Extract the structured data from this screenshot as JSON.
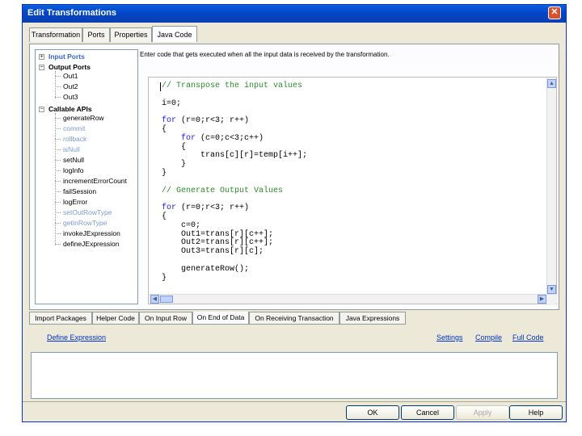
{
  "window": {
    "title": "Edit Transformations"
  },
  "top_tabs": [
    {
      "label": "Transformation"
    },
    {
      "label": "Ports"
    },
    {
      "label": "Properties"
    },
    {
      "label": "Java Code"
    }
  ],
  "tree": {
    "input_ports": "Input Ports",
    "output_ports": "Output Ports",
    "outputs": [
      "Out1",
      "Out2",
      "Out3"
    ],
    "callable_apis": "Callable APIs",
    "apis": [
      "generateRow",
      "commit",
      "rollback",
      "isNull",
      "setNull",
      "logInfo",
      "incrementErrorCount",
      "failSession",
      "logError",
      "setOutRowType",
      "getInRowType",
      "invokeJExpression",
      "defineJExpression"
    ]
  },
  "instruction": "Enter code that gets executed when all the input data is received by the transformation.",
  "code_lines": [
    "// Transpose the input values",
    "",
    "i=0;",
    "",
    "for (r=0;r<3; r++)",
    "{",
    "    for (c=0;c<3;c++)",
    "    {",
    "        trans[c][r]=temp[i++];",
    "    }",
    "}",
    "",
    "// Generate Output Values",
    "",
    "for (r=0;r<3; r++)",
    "{",
    "    c=0;",
    "    Out1=trans[r][c++];",
    "    Out2=trans[r][c++];",
    "    Out3=trans[r][c];",
    "",
    "    generateRow();",
    "}"
  ],
  "bottom_tabs": [
    {
      "label": "Import Packages"
    },
    {
      "label": "Helper Code"
    },
    {
      "label": "On Input Row"
    },
    {
      "label": "On End of Data"
    },
    {
      "label": "On Receiving Transaction"
    },
    {
      "label": "Java Expressions"
    }
  ],
  "links": {
    "define_expression": "Define Expression",
    "settings": "Settings",
    "compile": "Compile",
    "full_code": "Full Code"
  },
  "buttons": {
    "ok": "OK",
    "cancel": "Cancel",
    "apply": "Apply",
    "help": "Help"
  }
}
